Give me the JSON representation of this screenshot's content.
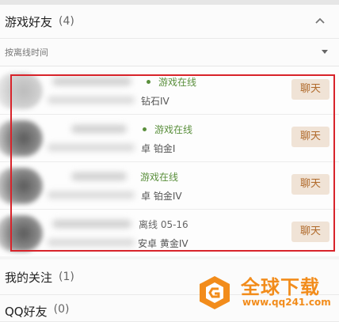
{
  "game_friends": {
    "title": "游戏好友",
    "count": "(4)"
  },
  "sort": {
    "label": "按离线时间"
  },
  "friends": [
    {
      "status": "游戏在线",
      "online": true,
      "rank": "钻石IV",
      "chat_label": "聊天"
    },
    {
      "status": "游戏在线",
      "online": true,
      "rank": "卓 铂金I",
      "chat_label": "聊天"
    },
    {
      "status": "游戏在线",
      "online": true,
      "rank": "卓 铂金IV",
      "chat_label": "聊天"
    },
    {
      "status": "离线 05-16",
      "online": false,
      "rank": "安卓 黄金IV",
      "chat_label": "聊天"
    }
  ],
  "my_follows": {
    "title": "我的关注",
    "count": "(1)"
  },
  "qq_friends": {
    "title": "QQ好友",
    "count": "(0)"
  },
  "watermark": {
    "title": "全球下载",
    "url": "www.qq241.com"
  },
  "colors": {
    "online": "#5a8f3c",
    "chat_button_bg": "#f0e3d6",
    "chat_button_text": "#b06a2b",
    "highlight": "#d8232a",
    "watermark": "#f28c1b"
  }
}
